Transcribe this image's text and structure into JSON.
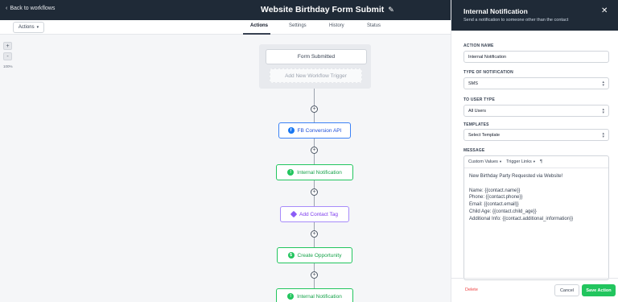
{
  "topbar": {
    "back_label": "Back to workflows",
    "title": "Website Birthday Form Submit"
  },
  "subbar": {
    "actions_label": "Actions",
    "tabs": [
      {
        "label": "Actions",
        "active": true
      },
      {
        "label": "Settings",
        "active": false
      },
      {
        "label": "History",
        "active": false
      },
      {
        "label": "Status",
        "active": false
      }
    ]
  },
  "canvas": {
    "zoom_in": "+",
    "zoom_out": "-",
    "zoom_level": "100%",
    "trigger": "Form Submitted",
    "add_trigger": "Add New Workflow Trigger",
    "nodes": [
      {
        "label": "FB Conversion API",
        "icon": "facebook-icon",
        "color": "#3b82f6"
      },
      {
        "label": "Internal Notification",
        "icon": "bell-icon",
        "color": "#22c55e"
      },
      {
        "label": "Add Contact Tag",
        "icon": "tag-icon",
        "color": "#8b5cf6"
      },
      {
        "label": "Create Opportunity",
        "icon": "dollar-icon",
        "color": "#22c55e"
      },
      {
        "label": "Internal Notification",
        "icon": "bell-icon",
        "color": "#22c55e"
      }
    ]
  },
  "panel": {
    "title": "Internal Notification",
    "subtitle": "Send a notification to someone other than the contact",
    "action_name_label": "ACTION NAME",
    "action_name_value": "Internal Notification",
    "type_label": "TYPE OF NOTIFICATION",
    "type_value": "SMS",
    "user_type_label": "TO USER TYPE",
    "user_type_value": "All Users",
    "templates_label": "TEMPLATES",
    "templates_value": "Select Template",
    "message_label": "MESSAGE",
    "toolbar": {
      "custom_values": "Custom Values",
      "trigger_links": "Trigger Links",
      "paragraph": "¶"
    },
    "message": "New Birthday Party Requested via Website!\n\nName: {{contact.name}}\nPhone: {{contact.phone}}\nEmail: {{contact.email}}\nChild Age: {{contact.child_age}}\nAdditional Info: {{contact.additional_information}}",
    "delete_label": "Delete",
    "cancel_label": "Cancel",
    "save_label": "Save Action"
  },
  "colors": {
    "header": "#1f2a37",
    "save": "#22c55e",
    "delete": "#ef4444"
  }
}
